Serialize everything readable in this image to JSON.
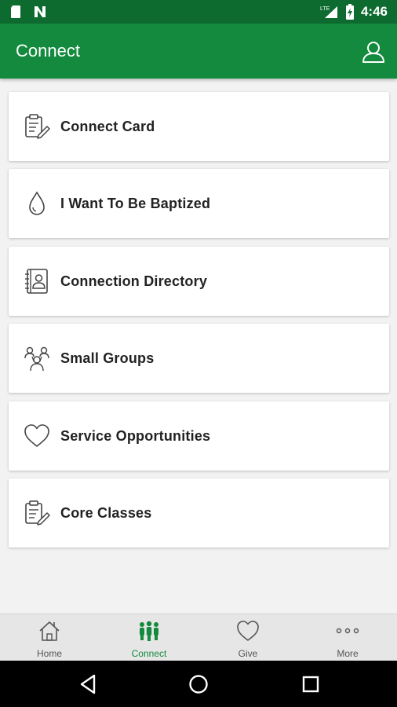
{
  "status_bar": {
    "time": "4:46",
    "left_icons": [
      "sd-card-icon",
      "notification-n-icon"
    ],
    "right_icons": [
      "lte-signal-icon",
      "battery-charging-icon"
    ],
    "network_label": "LTE"
  },
  "app_bar": {
    "title": "Connect",
    "profile_icon": "person-icon"
  },
  "menu_items": [
    {
      "label": "Connect Card",
      "icon": "clipboard-edit-icon"
    },
    {
      "label": "I Want To Be Baptized",
      "icon": "water-drop-icon"
    },
    {
      "label": "Connection Directory",
      "icon": "address-book-icon"
    },
    {
      "label": "Small Groups",
      "icon": "group-people-icon"
    },
    {
      "label": "Service Opportunities",
      "icon": "heart-icon"
    },
    {
      "label": "Core Classes",
      "icon": "clipboard-edit-icon"
    }
  ],
  "bottom_nav": [
    {
      "label": "Home",
      "icon": "home-icon",
      "active": false
    },
    {
      "label": "Connect",
      "icon": "people-icon",
      "active": true
    },
    {
      "label": "Give",
      "icon": "heart-icon",
      "active": false
    },
    {
      "label": "More",
      "icon": "more-dots-icon",
      "active": false
    }
  ],
  "colors": {
    "status_bar": "#0e6b30",
    "app_bar": "#138a3d",
    "accent": "#138a3d",
    "background": "#f2f2f2"
  }
}
